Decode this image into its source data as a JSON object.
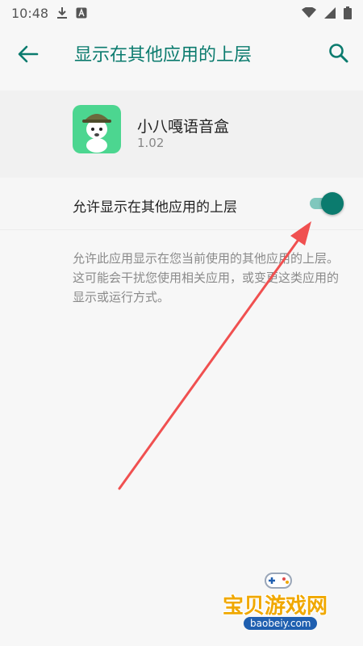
{
  "status_bar": {
    "time": "10:48",
    "icons": [
      "download-icon",
      "a-notification-icon",
      "wifi-icon",
      "signal-icon",
      "battery-icon"
    ]
  },
  "app_bar": {
    "title": "显示在其他应用的上层",
    "back_icon": "arrow-left-icon",
    "search_icon": "search-icon"
  },
  "app_info": {
    "name": "小八嘎语音盒",
    "version": "1.02"
  },
  "permission": {
    "label": "允许显示在其他应用的上层",
    "enabled": true
  },
  "description": "允许此应用显示在您当前使用的其他应用的上层。这可能会干扰您使用相关应用，或变更这类应用的显示或运行方式。",
  "watermark": {
    "text": "宝贝游戏网",
    "url": "baobeiy.com"
  },
  "colors": {
    "accent": "#0b7b6e",
    "annotation_arrow": "#f05050"
  }
}
